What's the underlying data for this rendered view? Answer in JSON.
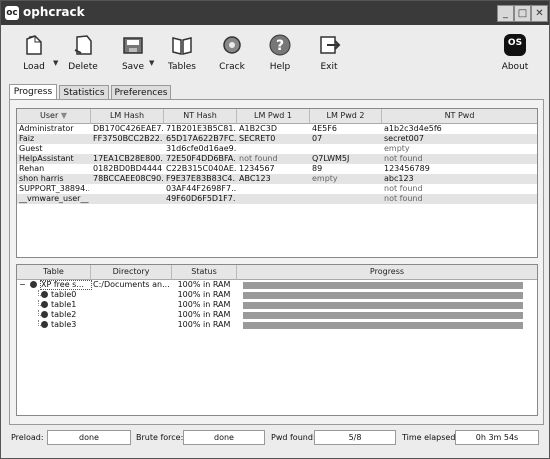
{
  "title": "ophcrack",
  "app_icon": "oc",
  "window_controls": [
    "_",
    "□",
    "✕"
  ],
  "toolbar": {
    "load": "Load",
    "delete": "Delete",
    "save": "Save",
    "tables": "Tables",
    "crack": "Crack",
    "help": "Help",
    "exit": "Exit",
    "about": "About",
    "about_icon_text": "OS"
  },
  "tabs": [
    "Progress",
    "Statistics",
    "Preferences"
  ],
  "users": {
    "columns": [
      "User",
      "LM Hash",
      "NT Hash",
      "LM Pwd 1",
      "LM Pwd 2",
      "NT Pwd"
    ],
    "rows": [
      [
        "Administrator",
        "DB170C426EAE7...",
        "71B201E3B5C81...",
        "A1B2C3D",
        "4E5F6",
        "a1b2c3d4e5f6"
      ],
      [
        "Faiz",
        "FF3750BCC2B22...",
        "65D17A622B7FC...",
        "SECRET0",
        "07",
        "secret007"
      ],
      [
        "Guest",
        "",
        "31d6cfe0d16ae9...",
        "",
        "",
        "empty"
      ],
      [
        "HelpAssistant",
        "17EA1CB28E800...",
        "72E50F4DD6BFA...",
        "not found",
        "Q7LWM5J",
        "not found"
      ],
      [
        "Rehan",
        "0182BD0BD4444...",
        "C22B315C040AE...",
        "1234567",
        "89",
        "123456789"
      ],
      [
        "shon harris",
        "78BCCAEE08C90...",
        "F9E37E83B83C4...",
        "ABC123",
        "empty",
        "abc123"
      ],
      [
        "SUPPORT_38894...",
        "",
        "03AF44F2698F7...",
        "",
        "",
        "not found"
      ],
      [
        "__vmware_user__",
        "",
        "49F60D6F5D1F7...",
        "",
        "",
        "not found"
      ]
    ]
  },
  "tables": {
    "columns": [
      "Table",
      "Directory",
      "Status",
      "Progress"
    ],
    "rows": [
      {
        "name": "XP free s...",
        "directory": "C:/Documents an...",
        "status": "100% in RAM",
        "progress": 100,
        "expander": "−"
      },
      {
        "name": "table0",
        "directory": "",
        "status": "100% in RAM",
        "progress": 100
      },
      {
        "name": "table1",
        "directory": "",
        "status": "100% in RAM",
        "progress": 100
      },
      {
        "name": "table2",
        "directory": "",
        "status": "100% in RAM",
        "progress": 100
      },
      {
        "name": "table3",
        "directory": "",
        "status": "100% in RAM",
        "progress": 100
      }
    ]
  },
  "status": {
    "preload_label": "Preload:",
    "preload_value": "done",
    "brute_label": "Brute force:",
    "brute_value": "done",
    "pwd_label": "Pwd found:",
    "pwd_value": "5/8",
    "time_label": "Time elapsed:",
    "time_value": "0h 3m 54s"
  }
}
